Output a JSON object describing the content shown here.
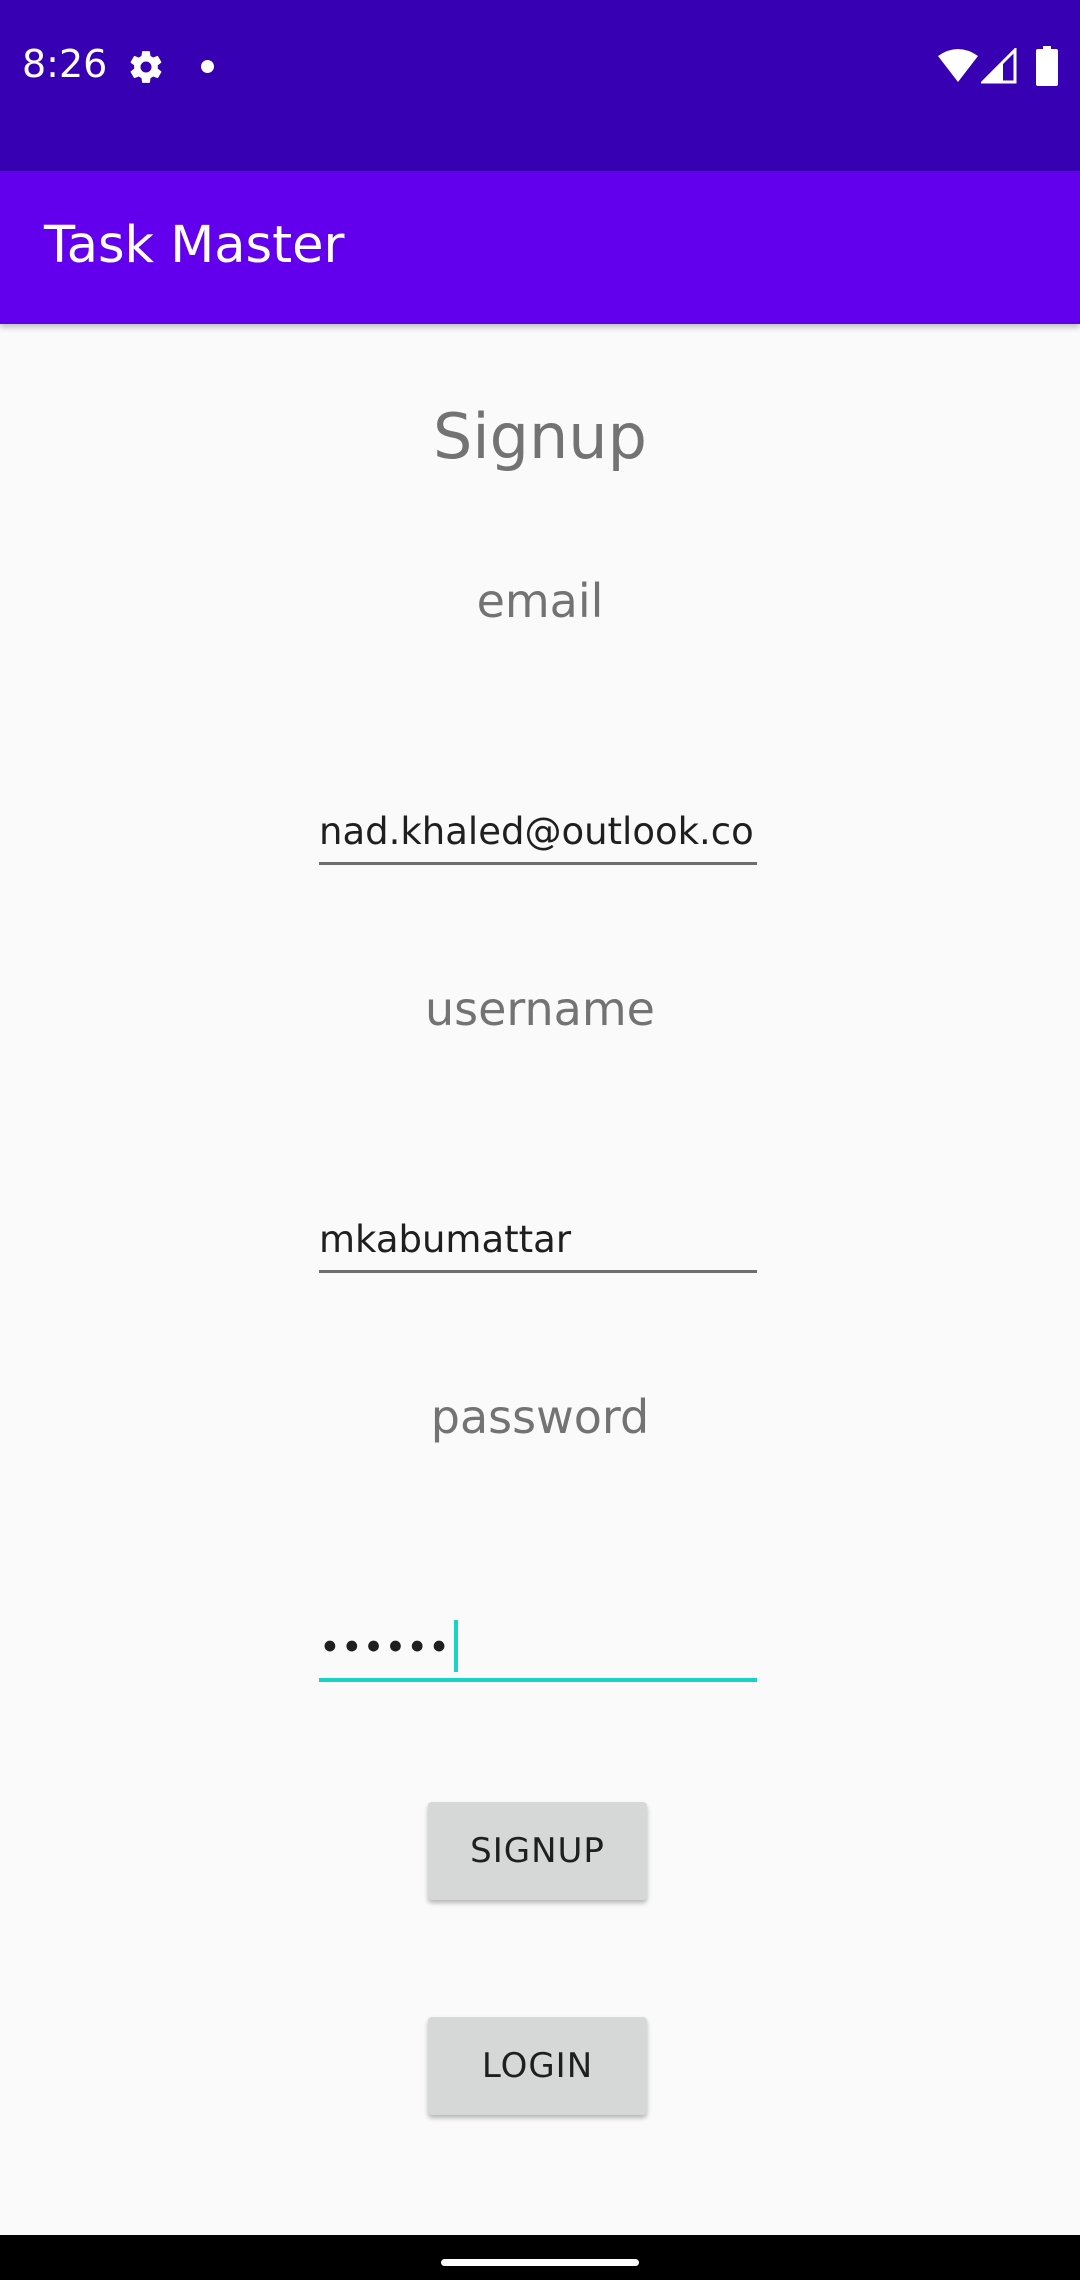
{
  "status_bar": {
    "time": "8:26",
    "icons": [
      "gear-icon",
      "notification-dot-icon",
      "wifi-icon",
      "signal-icon",
      "battery-icon"
    ]
  },
  "app_bar": {
    "title": "Task Master"
  },
  "form": {
    "title": "Signup",
    "email_label": "email",
    "email_value": "nad.khaled@outlook.com",
    "username_label": "username",
    "username_value": "mkabumattar",
    "password_label": "password",
    "password_value": "••••••"
  },
  "buttons": {
    "signup": "SIGNUP",
    "login": "LOGIN"
  },
  "colors": {
    "status_bar": "#3700B3",
    "app_bar": "#6200EE",
    "focus_accent": "#19D3C5",
    "background": "#FAFAFA",
    "button": "#D6D7D7"
  }
}
